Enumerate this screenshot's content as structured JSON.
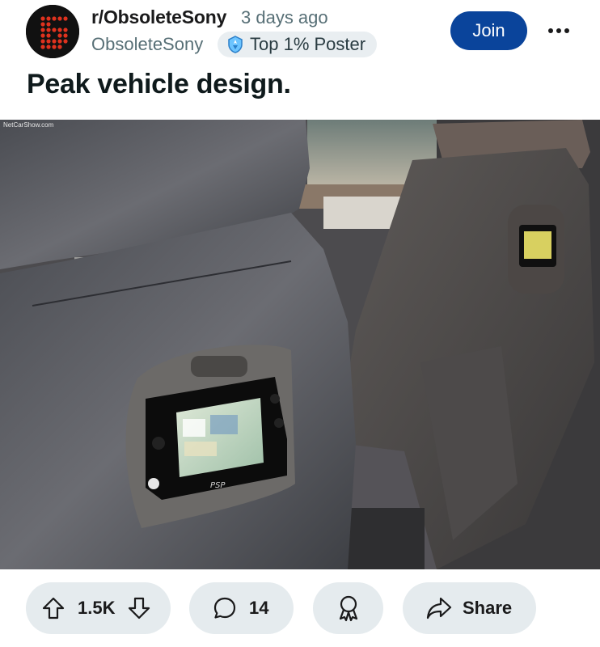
{
  "post": {
    "subreddit": "r/ObsoleteSony",
    "time": "3 days ago",
    "author": "ObsoleteSony",
    "flair": "Top 1% Poster",
    "join_label": "Join",
    "title": "Peak vehicle design.",
    "image_watermark": "NetCarShow.com",
    "psp_logo_text": "PSP"
  },
  "actions": {
    "vote_count": "1.5K",
    "comment_count": "14",
    "share_label": "Share"
  },
  "colors": {
    "join_button": "#0a449b",
    "pill_background": "#e5ebee",
    "avatar_accent": "#e0321e"
  },
  "icons": [
    "upvote-icon",
    "downvote-icon",
    "comment-icon",
    "award-icon",
    "share-icon",
    "more-icon",
    "flair-badge-icon"
  ]
}
